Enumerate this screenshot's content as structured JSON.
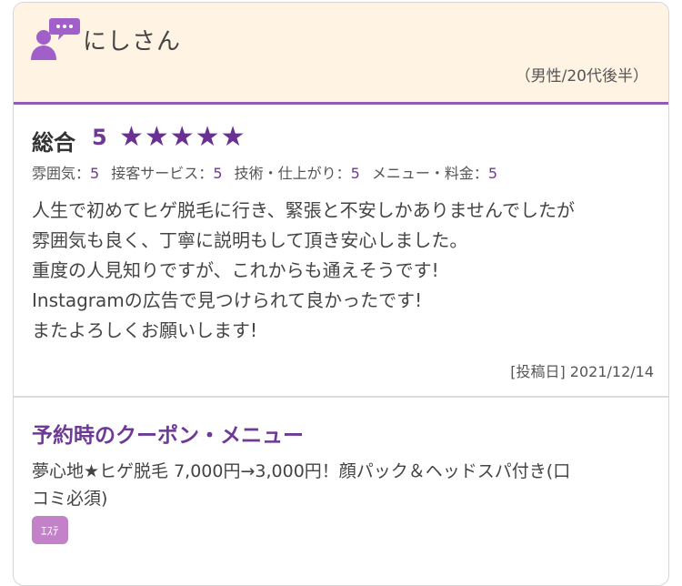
{
  "reviewer": {
    "name": "にしさん",
    "meta": "（男性/20代後半）"
  },
  "rating": {
    "total_label": "総合",
    "total_score": "5",
    "stars": "★★★★★",
    "items": [
      {
        "label": "雰囲気：",
        "value": "5"
      },
      {
        "label": "接客サービス：",
        "value": "5"
      },
      {
        "label": "技術・仕上がり：",
        "value": "5"
      },
      {
        "label": "メニュー・料金：",
        "value": "5"
      }
    ]
  },
  "review": {
    "lines": [
      "人生で初めてヒゲ脱毛に行き、緊張と不安しかありませんでしたが",
      "雰囲気も良く、丁寧に説明もして頂き安心しました。",
      "重度の人見知りですが、これからも通えそうです!",
      "Instagramの広告で見つけられて良かったです!",
      "またよろしくお願いします!"
    ],
    "post_date": "[投稿日] 2021/12/14"
  },
  "coupon": {
    "title": "予約時のクーポン・メニュー",
    "lines": [
      "夢心地★ヒゲ脱毛 7,000円→3,000円！顔パック＆ヘッドスパ付き(口",
      "コミ必須)"
    ],
    "tag": "ｴｽﾃ"
  },
  "colors": {
    "accent": "#6f3a95",
    "header_bg": "#fff3e3",
    "tag_bg": "#c381c9"
  }
}
